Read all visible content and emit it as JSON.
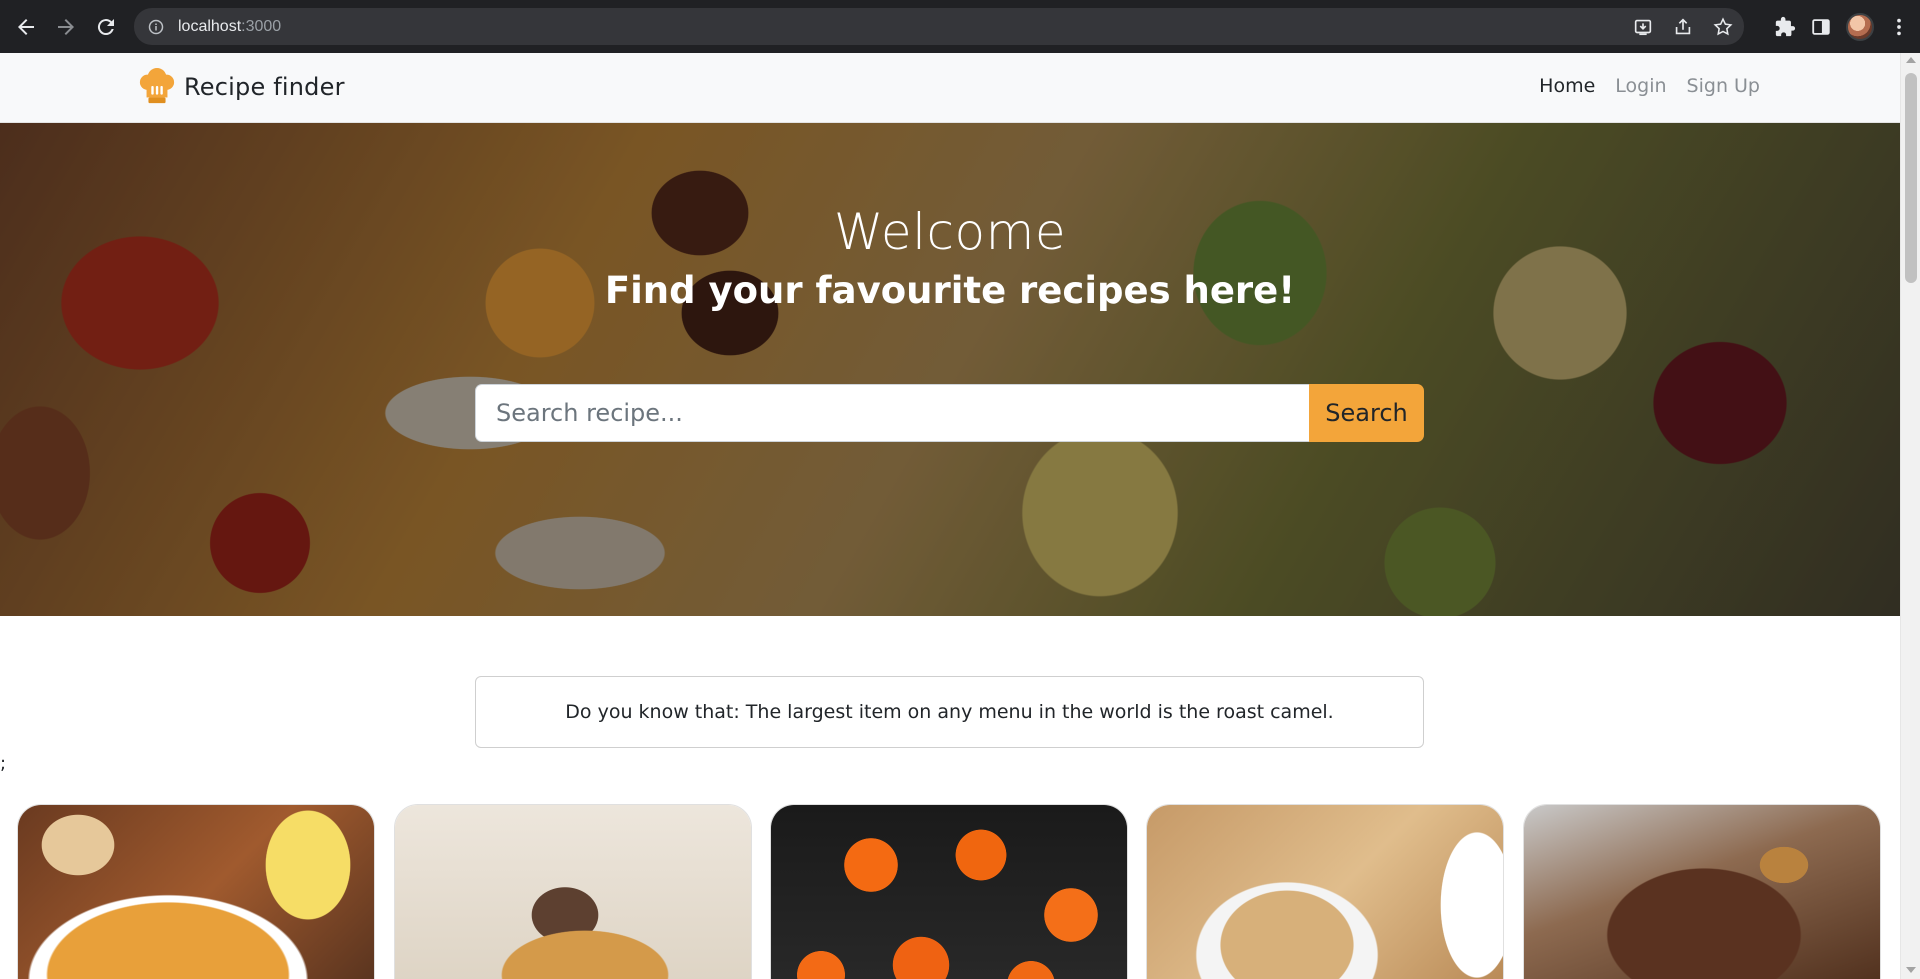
{
  "browser": {
    "url_host": "localhost",
    "url_port": ":3000"
  },
  "navbar": {
    "brand": "Recipe finder",
    "links": [
      {
        "label": "Home",
        "active": true
      },
      {
        "label": "Login",
        "active": false
      },
      {
        "label": "Sign Up",
        "active": false
      }
    ]
  },
  "hero": {
    "title": "Welcome",
    "subtitle": "Find your favourite recipes here!",
    "search_placeholder": "Search recipe...",
    "search_button": "Search"
  },
  "fact": {
    "text": "Do you know that: The largest item on any menu in the world is the roast camel."
  },
  "stray_text": ";",
  "colors": {
    "accent": "#f3a53a",
    "navbar_bg": "#f8f9fa",
    "chrome_bg": "#202124"
  },
  "cards": [
    {
      "image": "soup-with-lemon"
    },
    {
      "image": "meat-pastry"
    },
    {
      "image": "sushi-with-roe"
    },
    {
      "image": "stuffed-flatbread"
    },
    {
      "image": "beef-with-onion-rings"
    }
  ]
}
